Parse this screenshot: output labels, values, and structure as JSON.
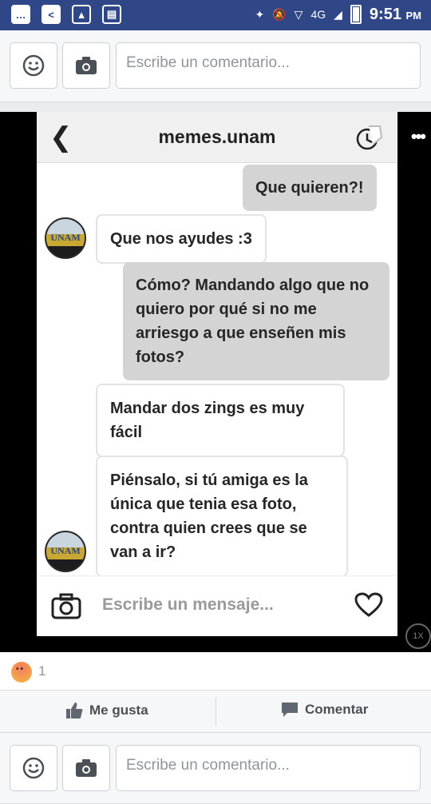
{
  "status_bar": {
    "time": "9:51",
    "ampm": "PM",
    "network": "4G"
  },
  "comment_bar": {
    "placeholder": "Escribe un comentario..."
  },
  "chat": {
    "title": "memes.unam",
    "avatar_text": "UNAM",
    "messages": [
      {
        "dir": "out",
        "text": "Que quieren?!"
      },
      {
        "dir": "in",
        "text": "Que nos ayudes :3"
      },
      {
        "dir": "out",
        "text": "Cómo? Mandando algo que no quiero por qué si no me arriesgo a que enseñen mis fotos?"
      },
      {
        "dir": "in",
        "text": "Mandar dos zings es muy fácil"
      },
      {
        "dir": "in",
        "text": "Piénsalo, si tú amiga es la única que tenia esa foto, contra quien crees que se van a ir?"
      }
    ],
    "composer_placeholder": "Escribe un mensaje...",
    "zoom_label": "1X"
  },
  "reactions": {
    "count": "1"
  },
  "actions": {
    "like_label": "Me gusta",
    "comment_label": "Comentar"
  },
  "colors": {
    "status_bar": "#2f4786",
    "outgoing_bubble": "#d4d4d4"
  }
}
